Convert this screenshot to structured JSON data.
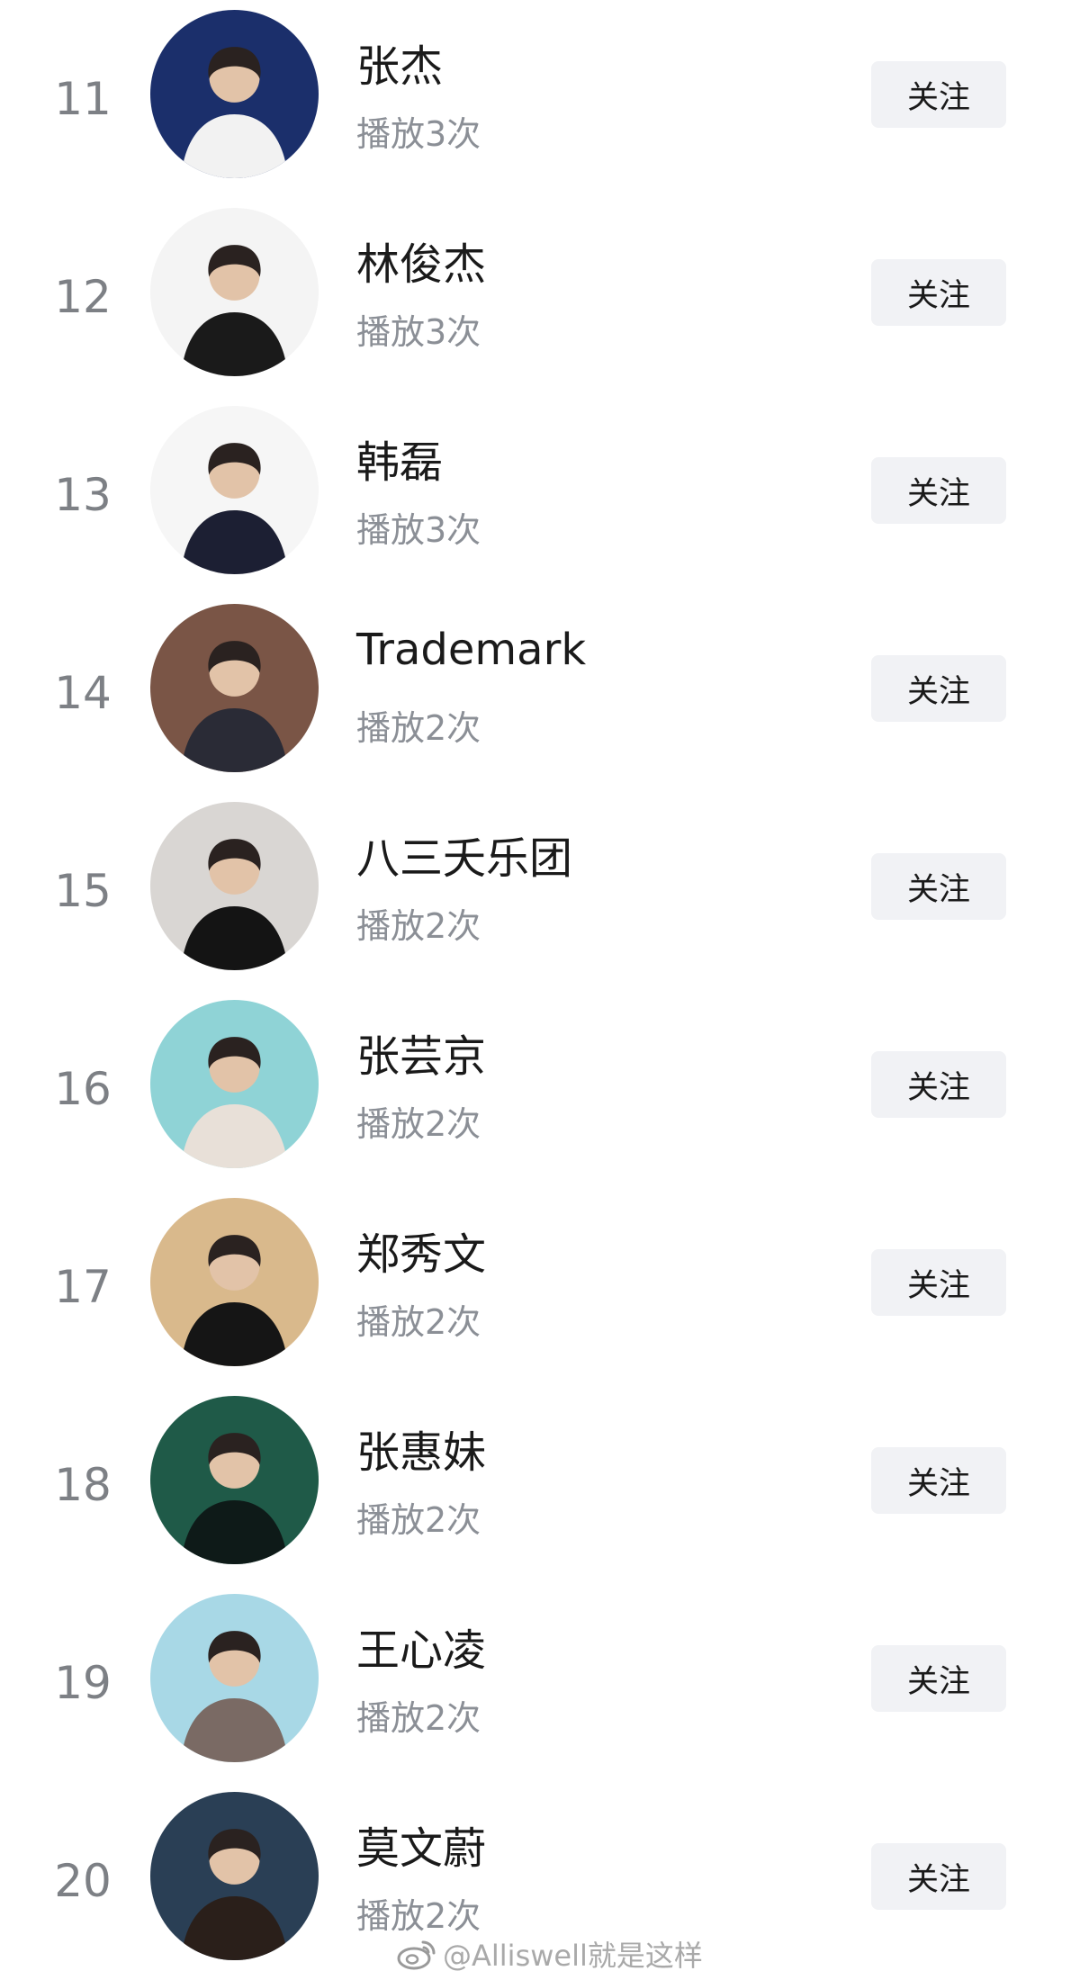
{
  "artists": [
    {
      "rank": "11",
      "name": "张杰",
      "plays": "播放3次",
      "follow_label": "关注",
      "avatar_bg": "#1b2f6b",
      "avatar_fg": "#f2f2f2"
    },
    {
      "rank": "12",
      "name": "林俊杰",
      "plays": "播放3次",
      "follow_label": "关注",
      "avatar_bg": "#f4f4f4",
      "avatar_fg": "#1a1a1a"
    },
    {
      "rank": "13",
      "name": "韩磊",
      "plays": "播放3次",
      "follow_label": "关注",
      "avatar_bg": "#f6f6f6",
      "avatar_fg": "#1c1f33"
    },
    {
      "rank": "14",
      "name": "Trademark",
      "plays": "播放2次",
      "follow_label": "关注",
      "avatar_bg": "#7a5546",
      "avatar_fg": "#2a2b36"
    },
    {
      "rank": "15",
      "name": "八三夭乐团",
      "plays": "播放2次",
      "follow_label": "关注",
      "avatar_bg": "#d9d6d3",
      "avatar_fg": "#141414"
    },
    {
      "rank": "16",
      "name": "张芸京",
      "plays": "播放2次",
      "follow_label": "关注",
      "avatar_bg": "#8fd3d6",
      "avatar_fg": "#e8e0d8"
    },
    {
      "rank": "17",
      "name": "郑秀文",
      "plays": "播放2次",
      "follow_label": "关注",
      "avatar_bg": "#d9b98c",
      "avatar_fg": "#151515"
    },
    {
      "rank": "18",
      "name": "张惠妹",
      "plays": "播放2次",
      "follow_label": "关注",
      "avatar_bg": "#1f5a48",
      "avatar_fg": "#0e1a18"
    },
    {
      "rank": "19",
      "name": "王心凌",
      "plays": "播放2次",
      "follow_label": "关注",
      "avatar_bg": "#a8d8e6",
      "avatar_fg": "#7a6a64"
    },
    {
      "rank": "20",
      "name": "莫文蔚",
      "plays": "播放2次",
      "follow_label": "关注",
      "avatar_bg": "#2a3f55",
      "avatar_fg": "#2a1f1a"
    }
  ],
  "watermark": "@Alliswell就是这样",
  "watermark_icon": "weibo-logo-icon"
}
